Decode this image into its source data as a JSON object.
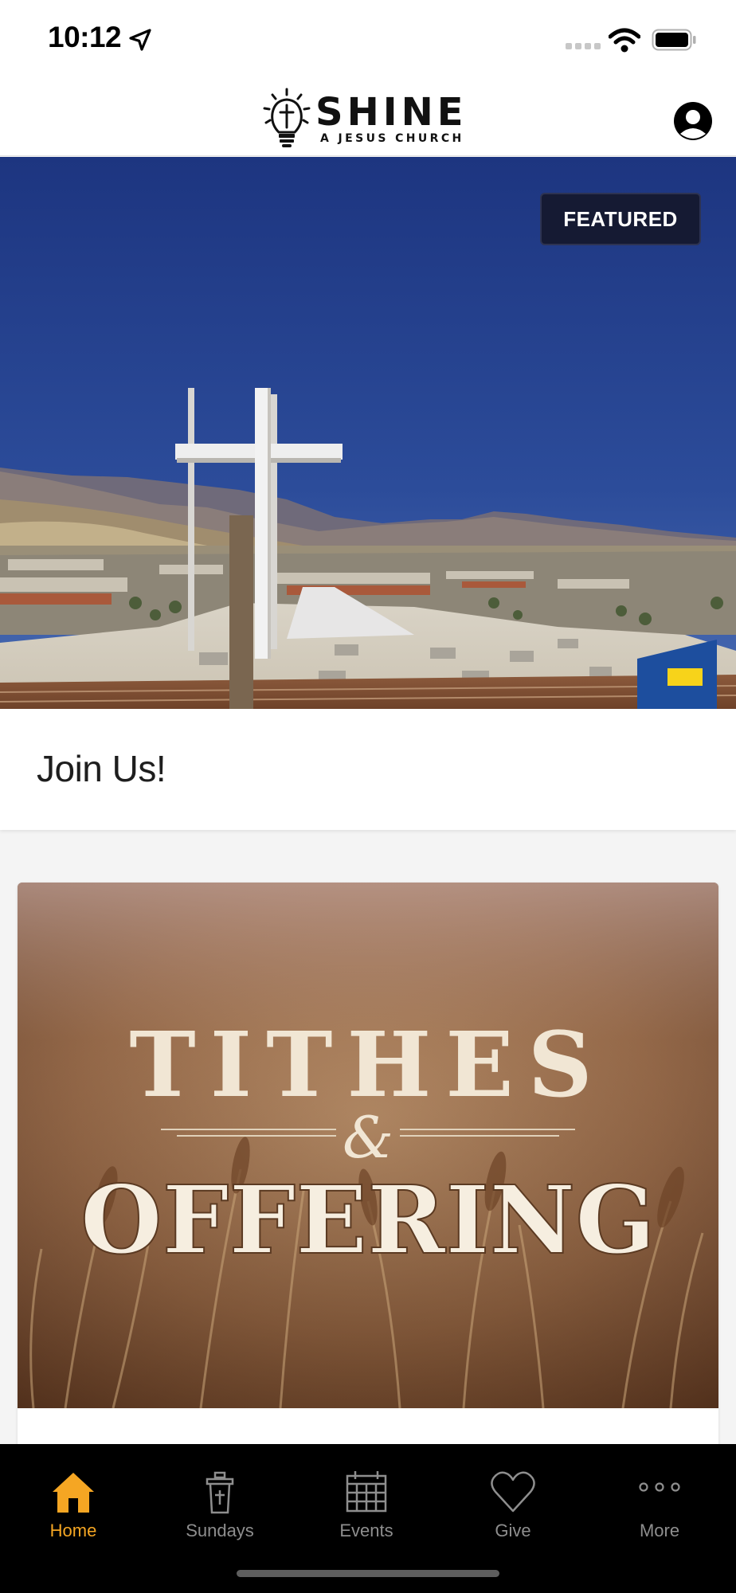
{
  "status_bar": {
    "time": "10:12",
    "icons": [
      "location-arrow-icon",
      "cellular-signal-icon",
      "wifi-icon",
      "battery-icon"
    ]
  },
  "header": {
    "logo_word": "SHINE",
    "logo_subtitle": "A JESUS CHURCH",
    "profile_icon": "user-profile-icon"
  },
  "featured": {
    "badge": "FEATURED",
    "title": "Join Us!"
  },
  "cards": [
    {
      "image_title": "TITHES",
      "image_ampersand": "&",
      "image_subtitle": "OFFERING"
    }
  ],
  "tab_bar": {
    "tabs": [
      {
        "label": "Home",
        "icon": "home-icon",
        "active": true
      },
      {
        "label": "Sundays",
        "icon": "pulpit-icon",
        "active": false
      },
      {
        "label": "Events",
        "icon": "calendar-icon",
        "active": false
      },
      {
        "label": "Give",
        "icon": "heart-icon",
        "active": false
      },
      {
        "label": "More",
        "icon": "more-dots-icon",
        "active": false
      }
    ]
  },
  "colors": {
    "accent": "#f5a623",
    "tab_bar_bg": "#000000",
    "tab_inactive": "#8e8e8e",
    "badge_bg": "#151a33",
    "sky": "#2a4893"
  }
}
